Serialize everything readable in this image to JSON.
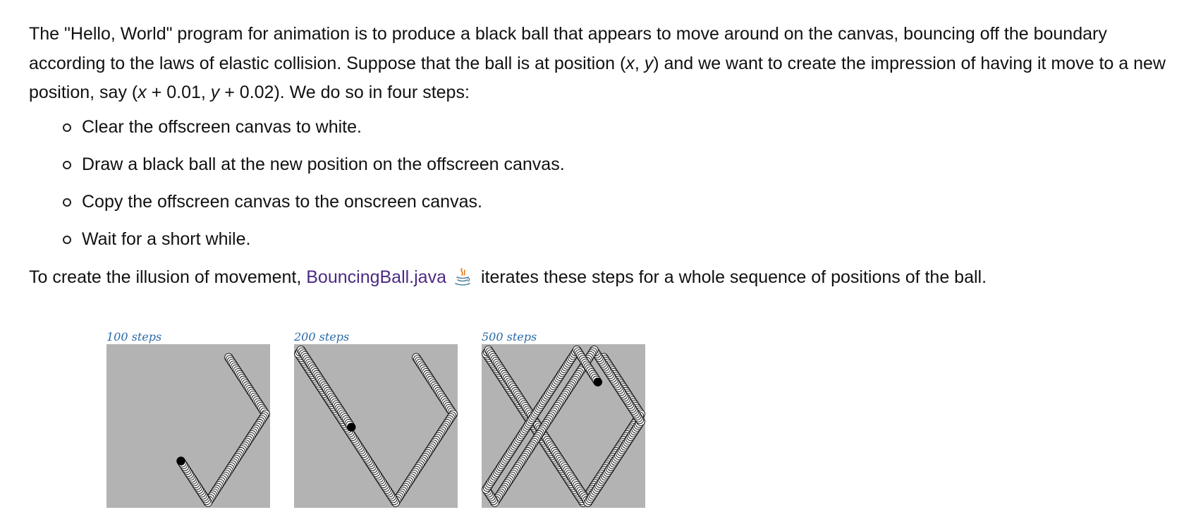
{
  "intro": {
    "part1": "The \"Hello, World\" program for animation is to produce a black ball that appears to move around on the canvas, bouncing off the boundary according to the laws of elastic collision. Suppose that the ball is at position (",
    "var_x": "x",
    "comma1": ", ",
    "var_y": "y",
    "part2": ") and we want to create the impression of having it move to a new position, say (",
    "var_x2": "x",
    "part3": " + 0.01, ",
    "var_y2": "y",
    "part4": " + 0.02). We do so in four steps:"
  },
  "steps": [
    "Clear the offscreen canvas to white.",
    "Draw a black ball at the new position on the offscreen canvas.",
    "Copy the offscreen canvas to the onscreen canvas.",
    "Wait for a short while."
  ],
  "outro": {
    "before": "To create the illusion of movement, ",
    "link_text": "BouncingBall.java",
    "after": " iterates these steps for a whole sequence of positions of the ball."
  },
  "icons": {
    "java": "java-coffee-cup-icon"
  },
  "figures": [
    {
      "caption": "100 steps",
      "steps": 100
    },
    {
      "caption": "200 steps",
      "steps": 200
    },
    {
      "caption": "500 steps",
      "steps": 500
    }
  ],
  "colors": {
    "link": "#4c2a85",
    "caption": "#2a6aa8",
    "canvas": "#b3b3b3"
  }
}
